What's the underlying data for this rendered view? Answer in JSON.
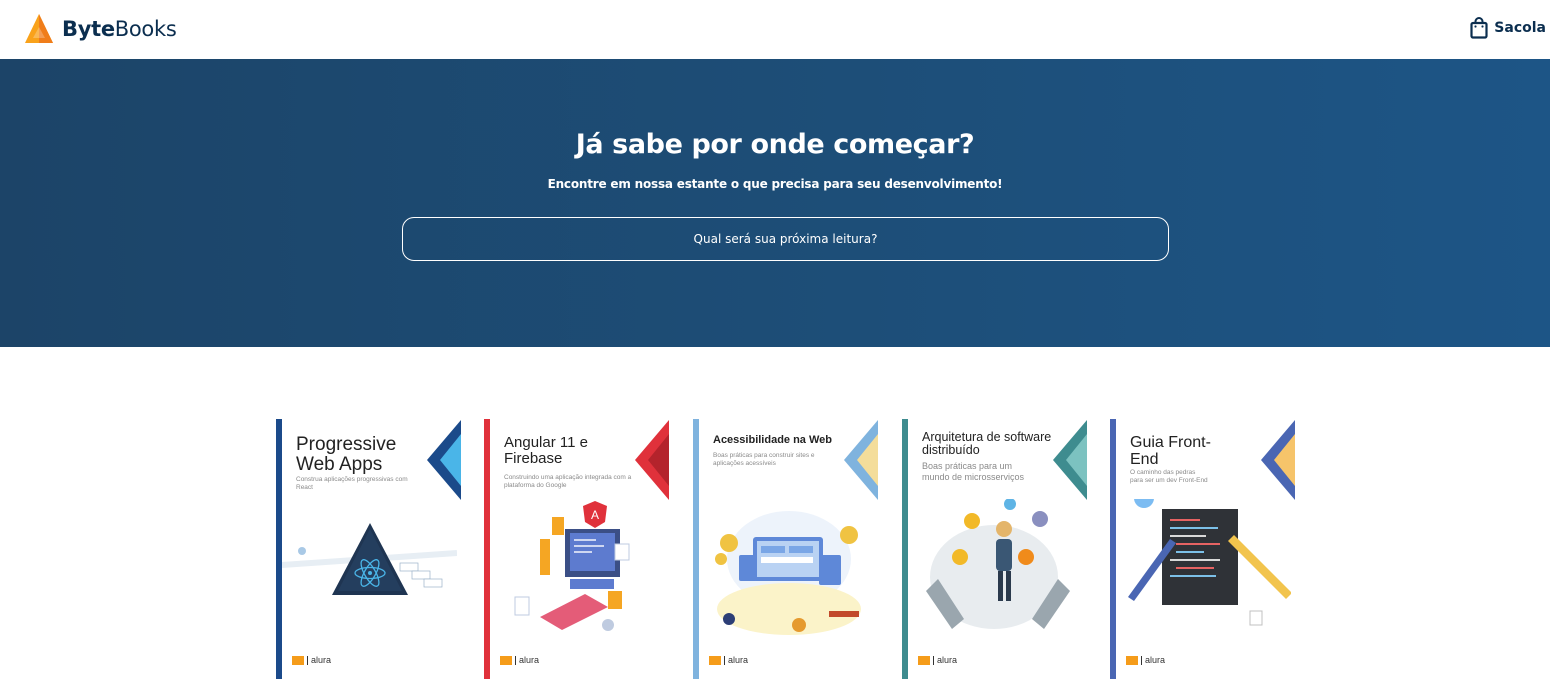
{
  "header": {
    "brand_bold": "Byte",
    "brand_rest": "Books",
    "bag_label": "Sacola",
    "brand_color": "#0b2e4f",
    "logo_colors": [
      "#f9a21b",
      "#f07d1a"
    ]
  },
  "hero": {
    "title": "Já sabe por onde começar?",
    "subtitle": "Encontre em nossa estante o que precisa para seu desenvolvimento!",
    "search_placeholder": "Qual será sua próxima leitura?",
    "background": "#1d4e78"
  },
  "books": [
    {
      "title": "Progressive Web Apps",
      "subtitle": "Construa aplicações progressivas com React",
      "accent": "#1b4a8a",
      "accent_light": "#4ab5e8",
      "footer_brand": "alura",
      "icon": "react-triangle-illustration"
    },
    {
      "title": "Angular 11 e Firebase",
      "subtitle": "Construindo uma aplicação integrada com a plataforma do Google",
      "accent": "#e0313b",
      "accent_light": "#b4232c",
      "footer_brand": "alura",
      "icon": "angular-computer-illustration"
    },
    {
      "title": "Acessibilidade na Web",
      "subtitle": "Boas práticas para construir sites e aplicações acessíveis",
      "accent": "#7fb3de",
      "accent_light": "#f4dd9a",
      "footer_brand": "alura",
      "icon": "accessibility-park-illustration"
    },
    {
      "title": "Arquitetura de software distribuído",
      "subtitle": "Boas práticas para um mundo de microsserviços",
      "accent": "#3e8c8f",
      "accent_light": "#7cc2c0",
      "footer_brand": "alura",
      "icon": "juggling-languages-illustration"
    },
    {
      "title": "Guia Front-End",
      "subtitle": "O caminho das pedras para ser um dev Front-End",
      "accent": "#4a66b3",
      "accent_light": "#f6c46a",
      "footer_brand": "alura",
      "icon": "code-ruler-illustration"
    }
  ]
}
